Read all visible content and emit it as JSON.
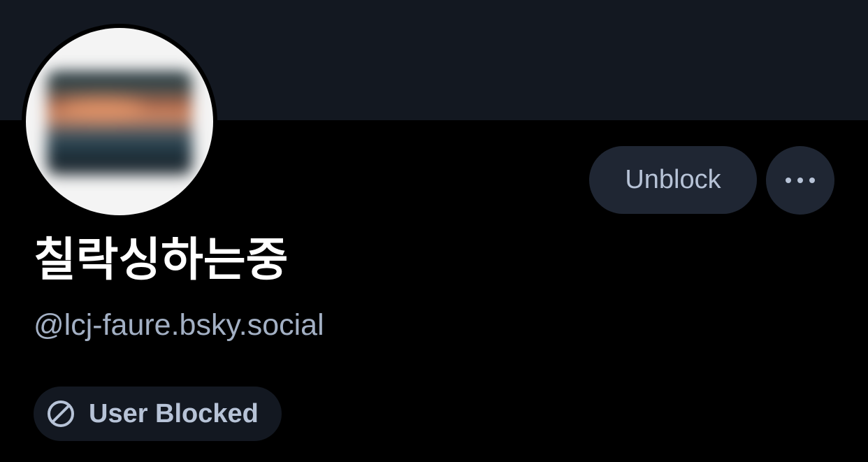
{
  "profile": {
    "display_name": "칠락싱하는중",
    "handle": "@lcj-faure.bsky.social",
    "avatar_state": "blurred"
  },
  "actions": {
    "unblock_label": "Unblock",
    "more_icon": "ellipsis-icon"
  },
  "status": {
    "label": "User Blocked",
    "icon": "blocked-icon"
  },
  "colors": {
    "background": "#000000",
    "banner": "#131821",
    "button_bg": "#1f2633",
    "button_text": "#b7c3d7",
    "handle_text": "#a3b0c4",
    "name_text": "#ffffff"
  }
}
